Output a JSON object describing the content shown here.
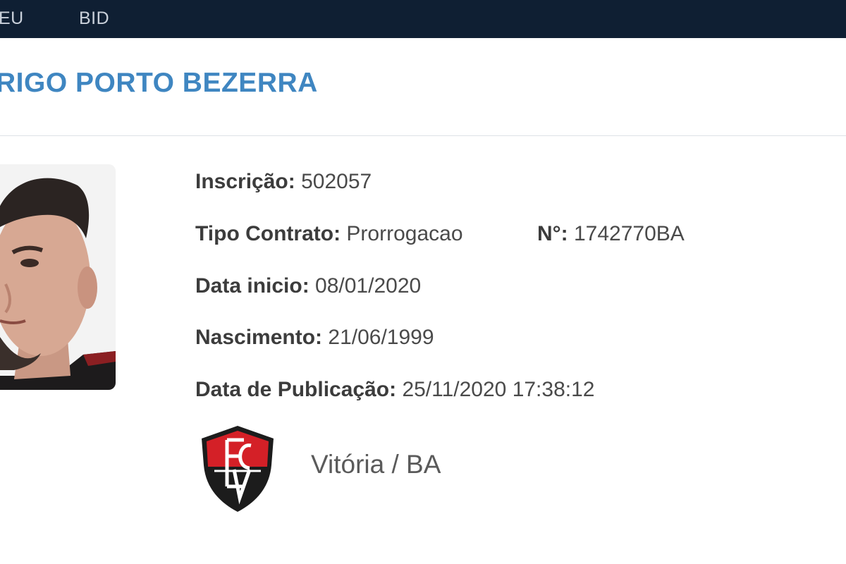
{
  "nav": {
    "items": [
      "EU",
      "BID"
    ]
  },
  "player": {
    "name": "RIGO PORTO BEZERRA"
  },
  "info": {
    "inscricao_label": "Inscrição:",
    "inscricao_value": "502057",
    "tipo_label": "Tipo Contrato:",
    "tipo_value": "Prorrogacao",
    "numero_label": "N°:",
    "numero_value": "1742770BA",
    "data_inicio_label": "Data inicio:",
    "data_inicio_value": "08/01/2020",
    "nascimento_label": "Nascimento:",
    "nascimento_value": "21/06/1999",
    "publicacao_label": "Data de Publicação:",
    "publicacao_value": "25/11/2020 17:38:12"
  },
  "club": {
    "name": "Vitória / BA",
    "crest_colors": [
      "#d42027",
      "#1c1c1c",
      "#ffffff"
    ]
  },
  "colors": {
    "topbar": "#0f1f33",
    "title": "#3f86c1"
  },
  "icons": {
    "photo": "player-photo",
    "crest": "club-crest-icon"
  }
}
